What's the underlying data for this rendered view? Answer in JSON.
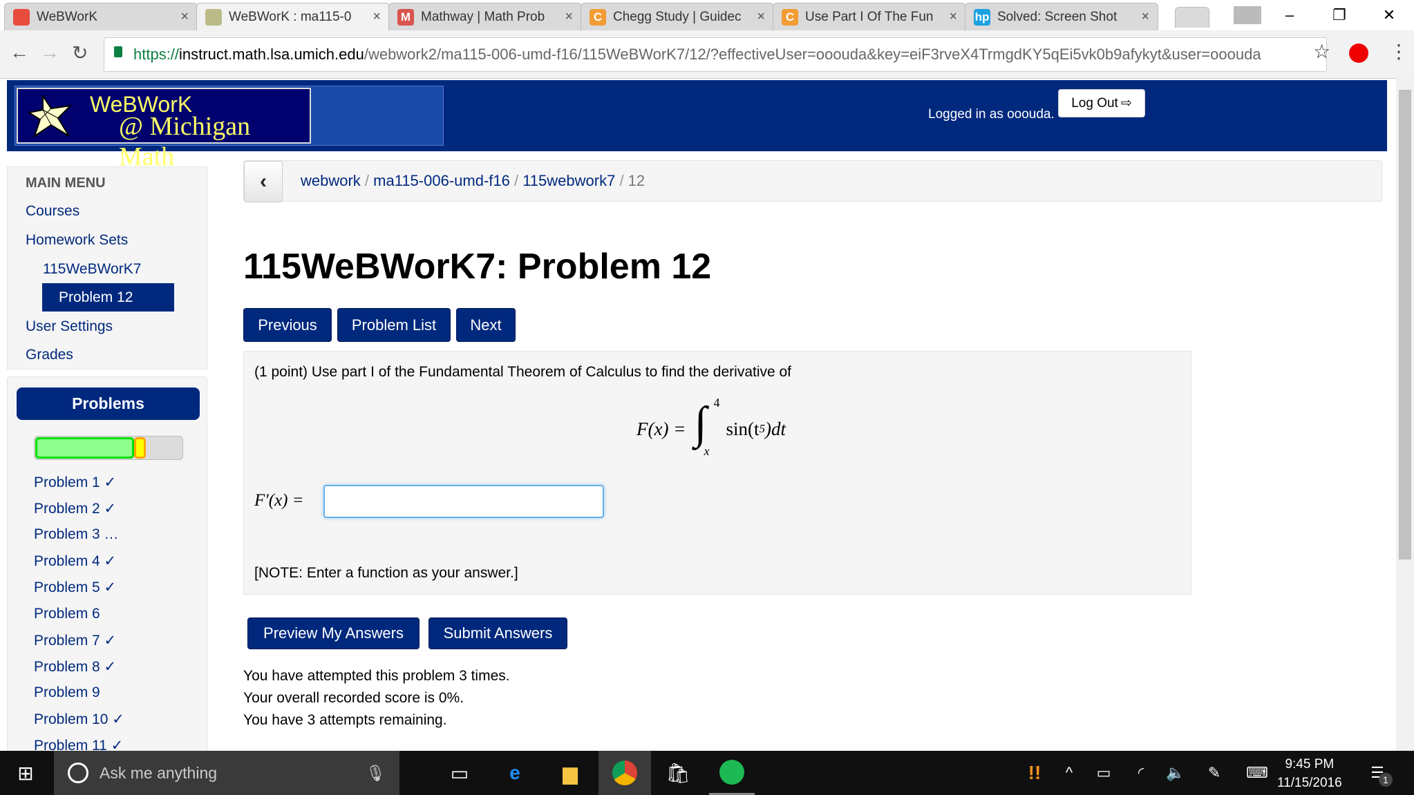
{
  "browser": {
    "tabs": [
      {
        "title": "WeBWorK",
        "icon": "webwork-red-icon",
        "color": "#e74c3c",
        "active": false
      },
      {
        "title": "WeBWorK : ma115-0",
        "icon": "webwork-star-icon",
        "color": "#bbbb88",
        "active": true
      },
      {
        "title": "Mathway | Math Prob",
        "icon": "M",
        "color": "#d9534f",
        "active": false
      },
      {
        "title": "Chegg Study | Guidec",
        "icon": "C",
        "color": "#f39c34",
        "active": false
      },
      {
        "title": "Use Part I Of The Fun",
        "icon": "C",
        "color": "#f39c34",
        "active": false
      },
      {
        "title": "Solved: Screen Shot",
        "icon": "hp",
        "color": "#1ba1e2",
        "active": false
      }
    ],
    "url": {
      "scheme": "https://",
      "host": "instruct.math.lsa.umich.edu",
      "path": "/webwork2/ma115-006-umd-f16/115WeBWorK7/12/?effectiveUser=ooouda&key=eiF3rveX4TrmgdKY5qEi5vk0b9afykyt&user=ooouda"
    }
  },
  "header": {
    "logo_line1": "WeBWorK",
    "logo_line2": "@ Michigan Math",
    "logged_in": "Logged in as ooouda.",
    "logout_label": "Log Out"
  },
  "main_menu": {
    "heading": "MAIN MENU",
    "courses": "Courses",
    "homework_sets": "Homework Sets",
    "set": "115WeBWorK7",
    "current_problem": "Problem 12",
    "user_settings": "User Settings",
    "grades": "Grades"
  },
  "problems_panel": {
    "label": "Problems",
    "progress": {
      "correct_percent": 67,
      "attempted_percent": 8
    },
    "items": [
      "Problem 1 ✓",
      "Problem 2 ✓",
      "Problem 3 …",
      "Problem 4 ✓",
      "Problem 5 ✓",
      "Problem 6",
      "Problem 7 ✓",
      "Problem 8 ✓",
      "Problem 9",
      "Problem 10 ✓",
      "Problem 11 ✓"
    ]
  },
  "breadcrumb": [
    "webwork",
    "ma115-006-umd-f16",
    "115webwork7",
    "12"
  ],
  "page_title": "115WeBWorK7: Problem 12",
  "nav_buttons": {
    "previous": "Previous",
    "problem_list": "Problem List",
    "next": "Next"
  },
  "problem": {
    "statement": "(1 point) Use part I of the Fundamental Theorem of Calculus to find the derivative of",
    "formula": {
      "lhs": "F(x) =",
      "upper": "4",
      "lower": "x",
      "integrand": "sin(t",
      "exp": "5",
      "tail": ")dt"
    },
    "answer_label": "F′(x) =",
    "answer_value": "",
    "note": "[NOTE: Enter a function as your answer.]"
  },
  "actions": {
    "preview": "Preview My Answers",
    "submit": "Submit Answers"
  },
  "status": [
    "You have attempted this problem 3 times.",
    "Your overall recorded score is 0%.",
    "You have 3 attempts remaining."
  ],
  "taskbar": {
    "search_placeholder": "Ask me anything",
    "time": "9:45 PM",
    "date": "11/15/2016",
    "notifications": "1"
  }
}
